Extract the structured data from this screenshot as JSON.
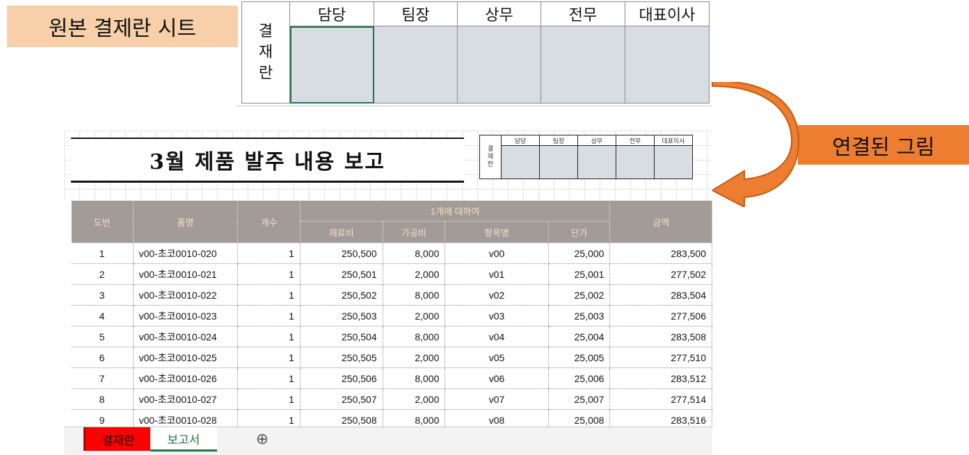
{
  "labels": {
    "original": "원본 결제란 시트",
    "linked": "연결된 그림"
  },
  "approval": {
    "side": [
      "결",
      "재",
      "란"
    ],
    "headers": [
      "담당",
      "팀장",
      "상무",
      "전무",
      "대표이사"
    ]
  },
  "report": {
    "title": "3월 제품 발주 내용 보고",
    "headers": {
      "no": "도번",
      "name": "품명",
      "count": "개수",
      "per_unit": "1개에 대하여",
      "material": "재료비",
      "processing": "가공비",
      "item_name": "항목명",
      "unit_price": "단가",
      "amount": "금액"
    },
    "rows": [
      {
        "no": "1",
        "name": "v00-초코0010-020",
        "count": "1",
        "material": "250,500",
        "processing": "8,000",
        "item": "v00",
        "price": "25,000",
        "amount": "283,500"
      },
      {
        "no": "2",
        "name": "v00-초코0010-021",
        "count": "1",
        "material": "250,501",
        "processing": "2,000",
        "item": "v01",
        "price": "25,001",
        "amount": "277,502"
      },
      {
        "no": "3",
        "name": "v00-초코0010-022",
        "count": "1",
        "material": "250,502",
        "processing": "8,000",
        "item": "v02",
        "price": "25,002",
        "amount": "283,504"
      },
      {
        "no": "4",
        "name": "v00-초코0010-023",
        "count": "1",
        "material": "250,503",
        "processing": "2,000",
        "item": "v03",
        "price": "25,003",
        "amount": "277,506"
      },
      {
        "no": "5",
        "name": "v00-초코0010-024",
        "count": "1",
        "material": "250,504",
        "processing": "8,000",
        "item": "v04",
        "price": "25,004",
        "amount": "283,508"
      },
      {
        "no": "6",
        "name": "v00-초코0010-025",
        "count": "1",
        "material": "250,505",
        "processing": "2,000",
        "item": "v05",
        "price": "25,005",
        "amount": "277,510"
      },
      {
        "no": "7",
        "name": "v00-초코0010-026",
        "count": "1",
        "material": "250,506",
        "processing": "8,000",
        "item": "v06",
        "price": "25,006",
        "amount": "283,512"
      },
      {
        "no": "8",
        "name": "v00-초코0010-027",
        "count": "1",
        "material": "250,507",
        "processing": "2,000",
        "item": "v07",
        "price": "25,007",
        "amount": "277,514"
      },
      {
        "no": "9",
        "name": "v00-초코0010-028",
        "count": "1",
        "material": "250,508",
        "processing": "8,000",
        "item": "v08",
        "price": "25,008",
        "amount": "283,516"
      }
    ]
  },
  "tabs": {
    "approval": "결재란",
    "report": "보고서",
    "add": "⊕"
  },
  "colors": {
    "header_fill": "#a29b97",
    "header_text": "#f8dec6",
    "approval_tab": "#ff0000",
    "active_tab_text": "#217346",
    "arrow": "#ed7d31",
    "signature_fill": "#d8dde3"
  },
  "icons": {
    "arrow": "curved-arrow-icon",
    "add_sheet": "plus-circle-icon"
  }
}
